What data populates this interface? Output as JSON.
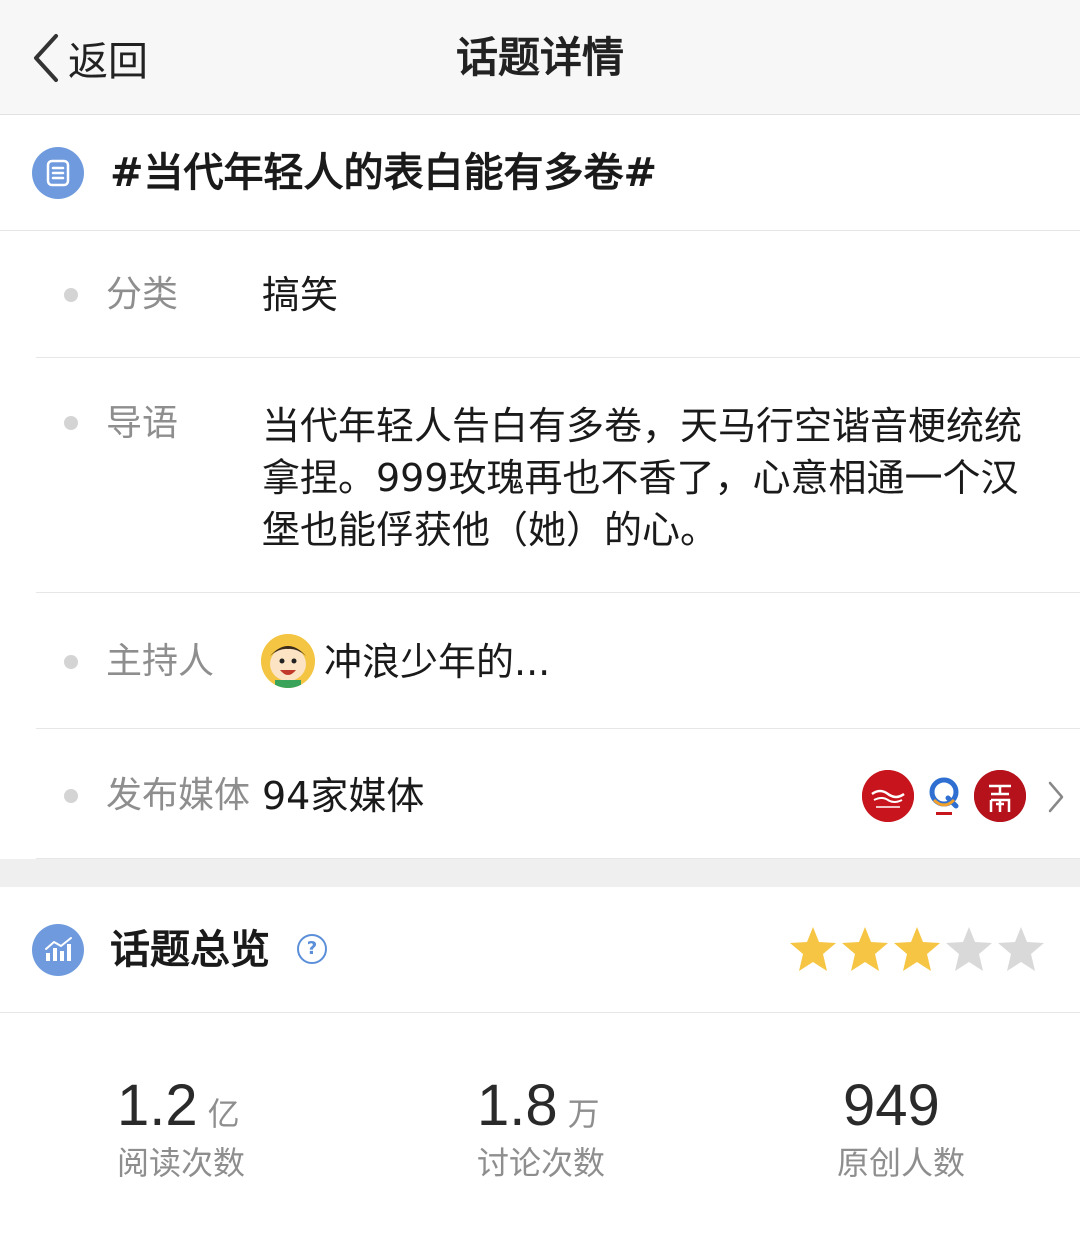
{
  "nav": {
    "back_label": "返回",
    "title": "话题详情"
  },
  "topic": {
    "title": "#当代年轻人的表白能有多卷#",
    "icon": "list-icon"
  },
  "info": {
    "category": {
      "label": "分类",
      "value": "搞笑"
    },
    "intro": {
      "label": "导语",
      "value": "当代年轻人告白有多卷，天马行空谐音梗统统拿捏。999玫瑰再也不香了，心意相通一个汉堡也能俘获他（她）的心。"
    },
    "host": {
      "label": "主持人",
      "value": "冲浪少年的..."
    },
    "media": {
      "label": "发布媒体",
      "value": "94家媒体",
      "logos": [
        "media-logo-henan-daily",
        "media-logo-q",
        "media-logo-henan"
      ]
    }
  },
  "overview": {
    "title": "话题总览",
    "rating": 3,
    "rating_max": 5,
    "star_color_on": "#f5c543",
    "star_color_off": "#d9d9d9",
    "stats": [
      {
        "number": "1.2",
        "unit": "亿",
        "label": "阅读次数"
      },
      {
        "number": "1.8",
        "unit": "万",
        "label": "讨论次数"
      },
      {
        "number": "949",
        "unit": "",
        "label": "原创人数"
      }
    ]
  },
  "colors": {
    "accent": "#6f9bde",
    "label_gray": "#8e8e8e"
  }
}
